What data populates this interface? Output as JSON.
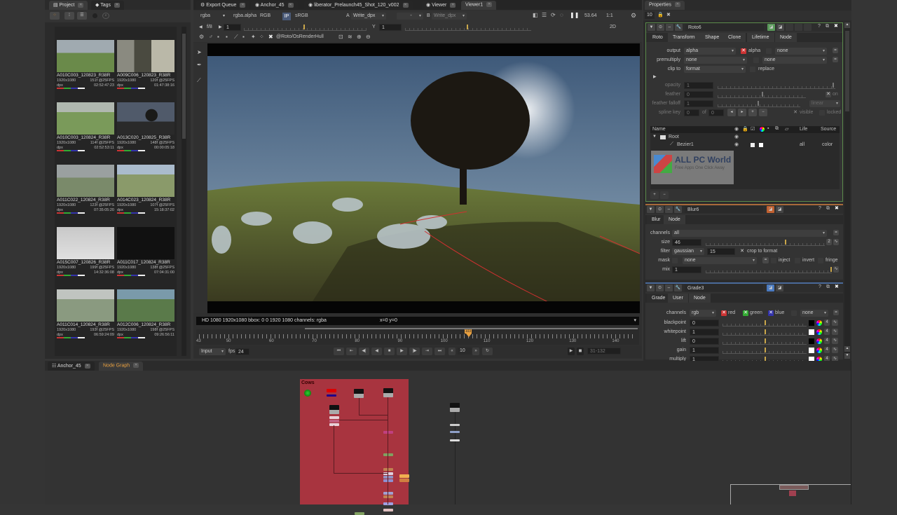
{
  "project_panel": {
    "tabs": [
      {
        "label": "Project",
        "icon": "document-icon"
      },
      {
        "label": "Tags",
        "icon": "tag-icon"
      }
    ],
    "toolbar_icons": [
      "grid-large-icon",
      "grid-small-icon",
      "list-icon",
      "circle-icon",
      "search-icon"
    ],
    "clips": [
      {
        "name": "A010C003_120823_R38R",
        "res": "1920x1080",
        "frames": "151f @25FPS",
        "format": "dpx",
        "timecode": "02:52:47:23",
        "thumb": "field"
      },
      {
        "name": "A009C006_120823_R38R",
        "res": "1920x1080",
        "frames": "120f @25FPS",
        "format": "dpx",
        "timecode": "01:47:38:16",
        "thumb": "hay"
      },
      {
        "name": "A010C003_120824_R38R",
        "res": "1920x1080",
        "frames": "114f @25FPS",
        "format": "dpx",
        "timecode": "02:52:53:11",
        "thumb": "field2"
      },
      {
        "name": "A013C020_120825_R38R",
        "res": "1920x1080",
        "frames": "148f @25FPS",
        "format": "dpx",
        "timecode": "00:00:05:18",
        "thumb": "tree"
      },
      {
        "name": "A011C022_120824_R38R",
        "res": "1920x1080",
        "frames": "123f @25FPS",
        "format": "dpx",
        "timecode": "07:35:05:20",
        "thumb": "fog"
      },
      {
        "name": "A014C023_120824_R38R",
        "res": "1920x1080",
        "frames": "107f @25FPS",
        "format": "dpx",
        "timecode": "15:18:37:02",
        "thumb": "bales"
      },
      {
        "name": "A015C007_120826_R38R",
        "res": "1920x1080",
        "frames": "199f @25FPS",
        "format": "dpx",
        "timecode": "14:32:36:08",
        "thumb": "milk"
      },
      {
        "name": "A011C017_120824_R38R",
        "res": "1920x1080",
        "frames": "138f @25FPS",
        "format": "dpx",
        "timecode": "07:04:31:00",
        "thumb": "black"
      },
      {
        "name": "A011C014_120824_R38R",
        "res": "1920x1080",
        "frames": "193f @25FPS",
        "format": "dpx",
        "timecode": "06:59:24:09",
        "thumb": "mist"
      },
      {
        "name": "A012C006_120824_R38R",
        "res": "1920x1080",
        "frames": "198f @25FPS",
        "format": "dpx",
        "timecode": "09:26:56:11",
        "thumb": "hill"
      }
    ]
  },
  "viewer": {
    "tabs": [
      {
        "label": "Export Queue",
        "icon": "gear-icon"
      },
      {
        "label": "Anchor_45",
        "icon": "eye-icon"
      },
      {
        "label": "liberator_Prelaunch45_Shot_120_v002",
        "icon": "eye-icon"
      },
      {
        "label": "Viewer",
        "icon": "eye-icon"
      },
      {
        "label": "Viewer1",
        "icon": ""
      }
    ],
    "channels": "rgba",
    "alpha": "rgba.alpha",
    "colorspace": "RGB",
    "ip_label": "IP",
    "lut": "sRGB",
    "input_a_label": "A",
    "input_a": "Write_dpx",
    "compare": "-",
    "input_b_label": "B",
    "input_b": "Write_dpx",
    "zoom": "53.64",
    "ratio": "1:1",
    "fstop": "f/8",
    "gain_value": "1",
    "gamma_label": "Y",
    "gamma_value": "1",
    "view_mode": "2D",
    "roto_path": "@Roto/OsRenderHull",
    "status": "HD 1080 1920x1080  bbox: 0 0 1920 1080 channels: rgba",
    "coords": "x=0 y=0"
  },
  "timeline": {
    "ticks": [
      "43",
      "50",
      "60",
      "70",
      "80",
      "90",
      "100",
      "110",
      "120",
      "130",
      "140"
    ],
    "current_frame": "103",
    "playhead_fraction": 0.615,
    "input_mode": "Input",
    "fps_label": "fps",
    "fps": "24",
    "step": "10",
    "range": "31-132"
  },
  "properties": {
    "tab": "Properties",
    "max_panels": "10",
    "roto": {
      "name": "Roto6",
      "tabs": [
        "Roto",
        "Transform",
        "Shape",
        "Clone",
        "Lifetime",
        "Node"
      ],
      "output_label": "output",
      "output": "alpha",
      "output_alpha_label": "alpha",
      "output_extra": "none",
      "premultiply_label": "premultiply",
      "premultiply": "none",
      "premultiply_extra": "none",
      "clip_label": "clip to",
      "clip": "format",
      "replace_label": "replace",
      "opacity_label": "opacity",
      "opacity": "1",
      "feather_label": "feather",
      "feather": "0",
      "feather_on": "on",
      "falloff_label": "feather falloff",
      "falloff": "1",
      "falloff_type": "linear",
      "spline_label": "spline key",
      "spline_key": "0",
      "of_label": "of",
      "spline_total": "0",
      "visible_label": "visible",
      "locked_label": "locked",
      "columns": [
        "Name",
        "Life",
        "Source"
      ],
      "layers": [
        {
          "name": "Root",
          "life": "",
          "source": ""
        },
        {
          "name": "Bezier1",
          "life": "all",
          "source": "color"
        }
      ]
    },
    "blur": {
      "name": "Blur6",
      "tabs": [
        "Blur",
        "Node"
      ],
      "channels_label": "channels",
      "channels": "all",
      "size_label": "size",
      "size": "46",
      "filter_label": "filter",
      "filter": "gaussian",
      "filter_quality": "15",
      "crop_label": "crop to format",
      "mask_label": "mask",
      "mask": "none",
      "inject_label": "inject",
      "invert_label": "invert",
      "fringe_label": "fringe",
      "mix_label": "mix",
      "mix": "1"
    },
    "grade": {
      "name": "Grade3",
      "tabs": [
        "Grade",
        "User",
        "Node"
      ],
      "channels_label": "channels",
      "channels": "rgb",
      "red": "red",
      "green": "green",
      "blue": "blue",
      "extra": "none",
      "rows": [
        {
          "label": "blackpoint",
          "value": "0",
          "swatch": "#000000"
        },
        {
          "label": "whitepoint",
          "value": "1",
          "swatch": "#ffffff"
        },
        {
          "label": "lift",
          "value": "0",
          "swatch": "#000000"
        },
        {
          "label": "gain",
          "value": "1",
          "swatch": "#ffffff"
        },
        {
          "label": "multiply",
          "value": "1",
          "swatch": "#ffffff"
        }
      ],
      "count": "4"
    }
  },
  "watermark": {
    "title": "ALL PC World",
    "subtitle": "Free Apps One Click Away"
  },
  "nodegraph": {
    "tabs": [
      {
        "label": "Anchor_45"
      },
      {
        "label": "Node Graph"
      }
    ],
    "backdrop_label": "Cows"
  },
  "colors": {
    "accent": "#e8a040",
    "backdrop": "#a8343f",
    "roto_border": "#5a8a4a",
    "grade_border": "#4a6a9a"
  }
}
